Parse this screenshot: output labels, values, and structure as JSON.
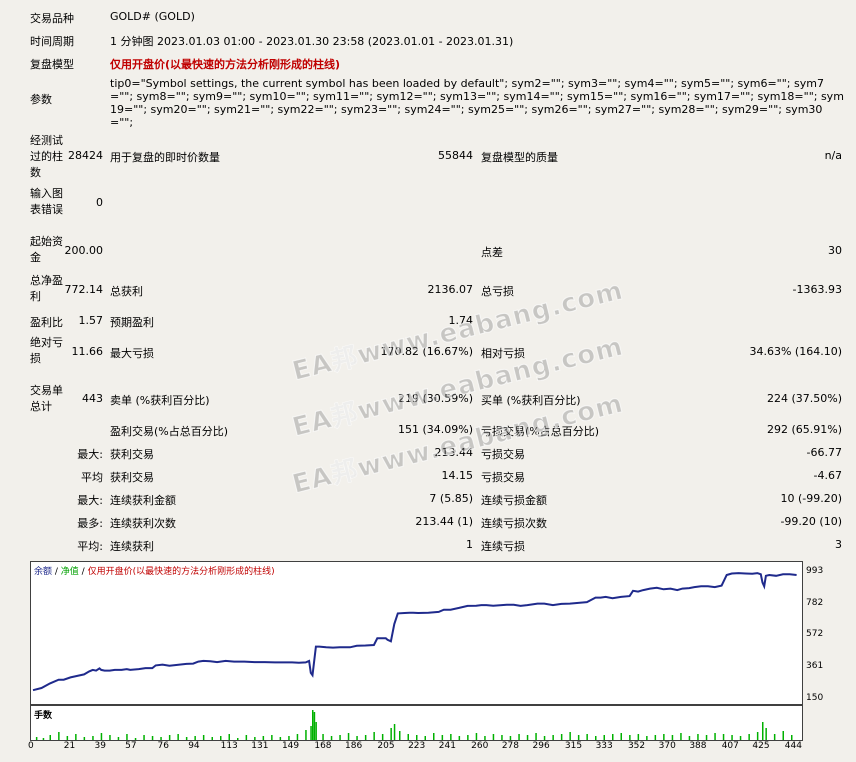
{
  "report": {
    "symbol": {
      "label": "交易品种",
      "value": "GOLD# (GOLD)"
    },
    "period": {
      "label": "时间周期",
      "value": "1 分钟图 2023.01.03 01:00 - 2023.01.30 23:58 (2023.01.01 - 2023.01.31)"
    },
    "model": {
      "label": "复盘模型",
      "value": "仅用开盘价(以最快速的方法分析刚形成的柱线)"
    },
    "params": {
      "label": "参数",
      "value": "tip0=\"Symbol settings, the current symbol has been loaded by default\"; sym2=\"\"; sym3=\"\"; sym4=\"\"; sym5=\"\"; sym6=\"\"; sym7=\"\"; sym8=\"\"; sym9=\"\"; sym10=\"\"; sym11=\"\"; sym12=\"\"; sym13=\"\"; sym14=\"\"; sym15=\"\"; sym16=\"\"; sym17=\"\"; sym18=\"\"; sym19=\"\"; sym20=\"\"; sym21=\"\"; sym22=\"\"; sym23=\"\"; sym24=\"\"; sym25=\"\"; sym26=\"\"; sym27=\"\"; sym28=\"\"; sym29=\"\"; sym30=\"\";"
    }
  },
  "stats": {
    "bars_label_1": "经测试",
    "bars_label_2": "过的柱",
    "bars_label_3": "数",
    "bars_value": "28424",
    "ticks_label": "用于复盘的即时价数量",
    "ticks_value": "55844",
    "quality_label": "复盘模型的质量",
    "quality_value": "n/a",
    "errors_label_1": "输入图",
    "errors_label_2": "表错误",
    "errors_value": "0",
    "deposit_label_1": "起始资",
    "deposit_label_2": "金",
    "deposit_value": "200.00",
    "spread_label": "点差",
    "spread_value": "30",
    "netprofit_label_1": "总净盈",
    "netprofit_label_2": "利",
    "netprofit_value": "772.14",
    "grossprofit_label": "总获利",
    "grossprofit_value": "2136.07",
    "grossloss_label": "总亏损",
    "grossloss_value": "-1363.93",
    "pf_label": "盈利比",
    "pf_value": "1.57",
    "payoff_label": "预期盈利",
    "payoff_value": "1.74",
    "absdd_label_1": "绝对亏",
    "absdd_label_2": "损",
    "absdd_value": "11.66",
    "maxdd_label": "最大亏损",
    "maxdd_value": "170.82 (16.67%)",
    "reldd_label": "相对亏损",
    "reldd_value": "34.63% (164.10)",
    "trades_label_1": "交易单",
    "trades_label_2": "总计",
    "trades_value": "443",
    "short_label": "卖单 (%获利百分比)",
    "short_value": "219 (30.59%)",
    "long_label": "买单 (%获利百分比)",
    "long_value": "224 (37.50%)",
    "win_label": "盈利交易(%占总百分比)",
    "win_value": "151 (34.09%)",
    "loss_label": "亏损交易(%占总百分比)",
    "loss_value": "292 (65.91%)",
    "max1_prefix": "最大:",
    "largest_win_label": "获利交易",
    "largest_win_value": "213.44",
    "largest_loss_label": "亏损交易",
    "largest_loss_value": "-66.77",
    "avg1_prefix": "平均",
    "avg_win_label": "获利交易",
    "avg_win_value": "14.15",
    "avg_loss_label": "亏损交易",
    "avg_loss_value": "-4.67",
    "max2_prefix": "最大:",
    "cons_win_amt_label": "连续获利金额",
    "cons_win_amt_value": "7 (5.85)",
    "cons_loss_amt_label": "连续亏损金额",
    "cons_loss_amt_value": "10 (-99.20)",
    "most_prefix": "最多:",
    "cons_win_cnt_label": "连续获利次数",
    "cons_win_cnt_value": "213.44 (1)",
    "cons_loss_cnt_label": "连续亏损次数",
    "cons_loss_cnt_value": "-99.20 (10)",
    "avg2_prefix": "平均:",
    "avg_cons_win_label": "连续获利",
    "avg_cons_win_value": "1",
    "avg_cons_loss_label": "连续亏损",
    "avg_cons_loss_value": "3"
  },
  "chart_legend": {
    "balance": "余额",
    "equity": "净值",
    "model": "仅用开盘价(以最快速的方法分析刚形成的柱线)",
    "volume": "手数"
  },
  "colors": {
    "balance_line": "#1f2a8c",
    "equity_legend": "#00a000",
    "model_legend": "#c00000",
    "volume_bars": "#00b000"
  },
  "watermark": "EA邦www.eabang.com",
  "chart_data": {
    "type": "line",
    "title": "",
    "xlabel": "",
    "ylabel": "",
    "x_ticks": [
      0,
      21,
      39,
      57,
      76,
      94,
      113,
      131,
      149,
      168,
      186,
      205,
      223,
      241,
      260,
      278,
      296,
      315,
      333,
      352,
      370,
      388,
      407,
      425,
      444
    ],
    "y_ticks": [
      993,
      782,
      572,
      361,
      150
    ],
    "xlim": [
      0,
      450
    ],
    "ylim": [
      150,
      1040
    ],
    "series": [
      {
        "name": "余额",
        "x": [
          0,
          5,
          10,
          15,
          18,
          22,
          26,
          30,
          33,
          35,
          37,
          39,
          40,
          42,
          45,
          48,
          52,
          55,
          57,
          62,
          66,
          70,
          72,
          76,
          80,
          86,
          90,
          94,
          97,
          100,
          104,
          108,
          113,
          118,
          124,
          130,
          136,
          142,
          148,
          152,
          156,
          160,
          162,
          163,
          164,
          166,
          168,
          172,
          176,
          180,
          186,
          190,
          195,
          200,
          202,
          205,
          207,
          208,
          210,
          212,
          214,
          218,
          221,
          223,
          226,
          232,
          238,
          241,
          245,
          250,
          255,
          260,
          263,
          266,
          270,
          275,
          278,
          282,
          286,
          290,
          296,
          300,
          305,
          310,
          315,
          320,
          325,
          330,
          333,
          336,
          340,
          345,
          350,
          352,
          355,
          358,
          362,
          366,
          370,
          374,
          378,
          381,
          385,
          388,
          392,
          396,
          400,
          404,
          407,
          410,
          414,
          418,
          422,
          425,
          427,
          428,
          429,
          430,
          432,
          436,
          440,
          444,
          448
        ],
        "values": [
          215,
          230,
          260,
          285,
          285,
          300,
          310,
          320,
          340,
          350,
          345,
          360,
          350,
          345,
          345,
          350,
          350,
          355,
          350,
          355,
          362,
          362,
          380,
          385,
          378,
          385,
          390,
          392,
          405,
          410,
          408,
          402,
          410,
          405,
          405,
          402,
          402,
          400,
          400,
          400,
          398,
          400,
          410,
          330,
          315,
          505,
          505,
          500,
          498,
          500,
          500,
          510,
          512,
          515,
          560,
          560,
          560,
          550,
          540,
          655,
          725,
          728,
          730,
          730,
          728,
          730,
          735,
          750,
          750,
          762,
          775,
          776,
          780,
          780,
          776,
          780,
          782,
          782,
          775,
          780,
          790,
          790,
          780,
          788,
          790,
          795,
          800,
          830,
          830,
          835,
          826,
          835,
          840,
          875,
          870,
          880,
          890,
          895,
          885,
          890,
          880,
          890,
          893,
          900,
          905,
          905,
          900,
          910,
          980,
          990,
          993,
          990,
          988,
          993,
          985,
          930,
          905,
          975,
          980,
          975,
          985,
          985,
          980
        ]
      }
    ],
    "volume_series": {
      "name": "手数",
      "x": [
        2,
        6,
        10,
        15,
        20,
        25,
        30,
        35,
        40,
        45,
        50,
        55,
        60,
        65,
        70,
        75,
        80,
        85,
        90,
        95,
        100,
        105,
        110,
        115,
        120,
        125,
        130,
        135,
        140,
        145,
        150,
        155,
        160,
        163,
        164,
        165,
        166,
        170,
        175,
        180,
        185,
        190,
        195,
        200,
        205,
        210,
        212,
        215,
        220,
        225,
        230,
        235,
        240,
        245,
        250,
        255,
        260,
        265,
        270,
        275,
        280,
        285,
        290,
        295,
        300,
        305,
        310,
        315,
        320,
        325,
        330,
        335,
        340,
        345,
        350,
        355,
        360,
        365,
        370,
        375,
        380,
        385,
        390,
        395,
        400,
        405,
        410,
        415,
        420,
        425,
        428,
        430,
        435,
        440,
        445
      ],
      "values": [
        3,
        2,
        5,
        8,
        4,
        6,
        3,
        4,
        7,
        5,
        3,
        6,
        2,
        5,
        4,
        3,
        5,
        6,
        3,
        4,
        5,
        3,
        4,
        6,
        2,
        5,
        3,
        4,
        5,
        3,
        4,
        6,
        10,
        14,
        30,
        28,
        18,
        6,
        4,
        5,
        7,
        4,
        5,
        8,
        6,
        12,
        16,
        9,
        6,
        5,
        4,
        7,
        5,
        6,
        4,
        5,
        7,
        4,
        6,
        5,
        4,
        6,
        5,
        7,
        4,
        5,
        6,
        8,
        5,
        6,
        4,
        5,
        6,
        7,
        5,
        6,
        4,
        5,
        6,
        5,
        7,
        4,
        6,
        5,
        7,
        6,
        5,
        4,
        6,
        8,
        18,
        12,
        6,
        9,
        5
      ]
    }
  }
}
